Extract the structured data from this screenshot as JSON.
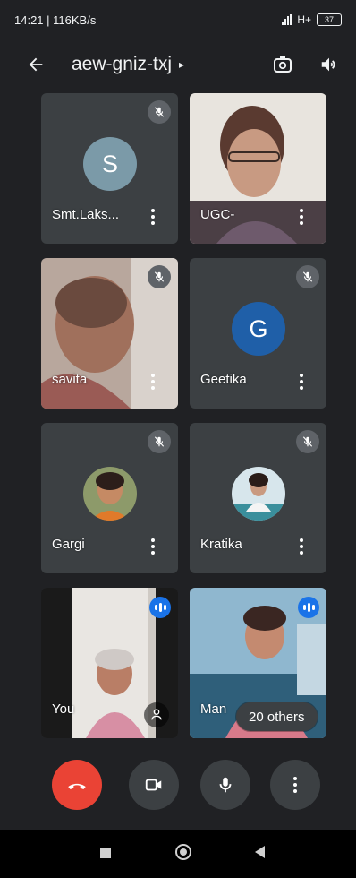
{
  "status_bar": {
    "time": "14:21",
    "speed": "116KB/s",
    "network": "H+",
    "battery": "37"
  },
  "meeting": {
    "code": "aew-gniz-txj",
    "code_caret": "▸"
  },
  "icons": {
    "back": "arrow-left-icon",
    "switch_camera": "switch-camera-icon",
    "speaker": "speaker-icon",
    "muted": "mic-off-icon",
    "menu": "more-vert-icon",
    "speaking": "audio-level-icon",
    "hand": "raise-hand-icon"
  },
  "participants": [
    {
      "name": "Smt.Laks...",
      "initial": "S",
      "avatar_color": "#7b9aa8",
      "muted": true
    },
    {
      "name": "UGC-",
      "muted": false
    },
    {
      "name": "savita",
      "muted": true
    },
    {
      "name": "Geetika",
      "initial": "G",
      "avatar_color": "#1f5fa8",
      "muted": true
    },
    {
      "name": "Gargi",
      "muted": true
    },
    {
      "name": "Kratika",
      "muted": true
    },
    {
      "name": "You",
      "muted": false,
      "speaking": true
    },
    {
      "name": "Man",
      "muted": false,
      "speaking": true
    }
  ],
  "others_label": "20 others",
  "controls": {
    "end_call": "end-call-icon",
    "camera": "camera-icon",
    "mic": "mic-icon",
    "more": "more-vert-icon"
  },
  "colors": {
    "background": "#202124",
    "tile": "#3c4043",
    "end_call": "#ea4335",
    "speaking": "#1a73e8"
  }
}
